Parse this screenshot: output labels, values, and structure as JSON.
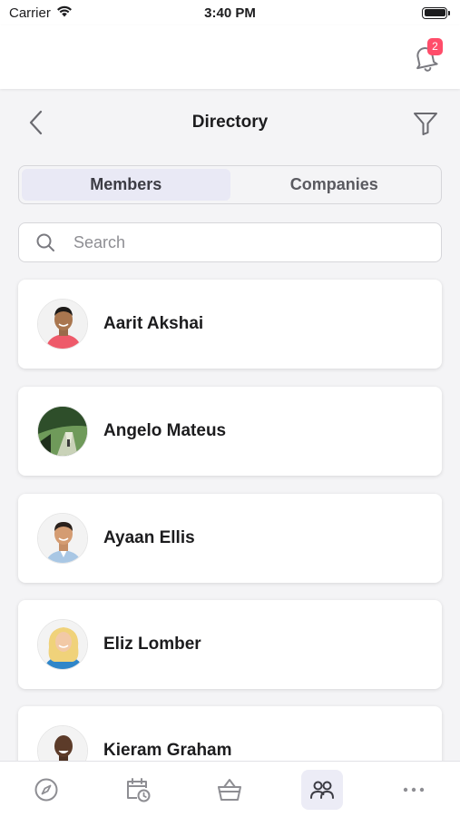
{
  "status_bar": {
    "carrier": "Carrier",
    "time": "3:40 PM"
  },
  "header": {
    "notification_count": "2",
    "badge_color": "#ff4d6a"
  },
  "nav": {
    "title": "Directory",
    "back_icon": "chevron-left-icon",
    "filter_icon": "filter-icon"
  },
  "tabs": {
    "members": "Members",
    "companies": "Companies",
    "selected": "Members"
  },
  "search": {
    "placeholder": "Search",
    "value": ""
  },
  "members": [
    {
      "name": "Aarit Akshai"
    },
    {
      "name": "Angelo Mateus"
    },
    {
      "name": "Ayaan Ellis"
    },
    {
      "name": "Eliz Lomber"
    },
    {
      "name": "Kieram Graham"
    }
  ],
  "tab_bar": {
    "items": [
      "compass-icon",
      "calendar-clock-icon",
      "basket-icon",
      "people-icon",
      "more-icon"
    ],
    "active": "people-icon"
  },
  "colors": {
    "accent_bg": "#e9e9f5",
    "background": "#f4f4f6"
  }
}
